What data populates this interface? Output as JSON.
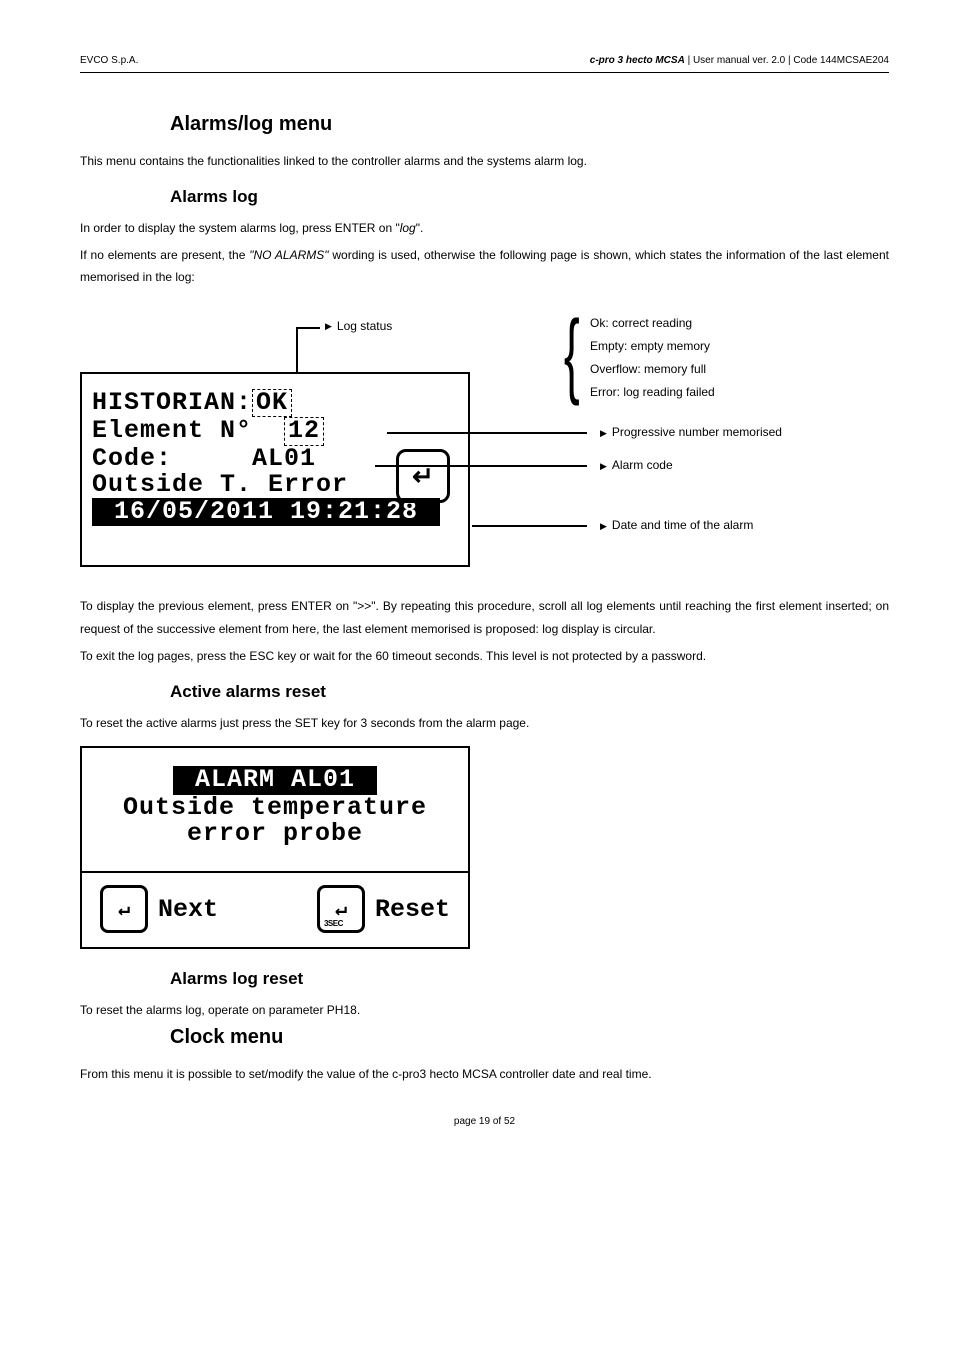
{
  "header": {
    "company": "EVCO S.p.A.",
    "product_bold": "c-pro 3 hecto MCSA",
    "product_rest": " | User manual ver. 2.0 | Code 144MCSAE204"
  },
  "sections": {
    "alarms_menu": {
      "title": "Alarms/log menu",
      "intro": "This menu contains the functionalities linked to the controller alarms and the systems alarm log."
    },
    "alarms_log": {
      "title": "Alarms log",
      "p1_a": "In order to display the system alarms log, press ENTER on \"",
      "p1_i": "log",
      "p1_b": "\".",
      "p2_a": "If no elements are present, the ",
      "p2_i": "\"NO ALARMS\"",
      "p2_b": " wording is used, otherwise the following page is shown, which states the information of the last element memorised in the log:",
      "p3": "To display the previous element, press ENTER on \">>\". By repeating this procedure, scroll all log elements until reaching the first element inserted; on request of the successive element from here, the last element memorised is proposed: log display is circular.",
      "p4": "To exit the log pages, press the ESC key or wait for the 60 timeout seconds. This level is not protected by a password."
    },
    "active_reset": {
      "title": "Active alarms reset",
      "p1": "To reset the active alarms just press the SET key for 3 seconds from the alarm page."
    },
    "log_reset": {
      "title": "Alarms log reset",
      "p1": "To reset the alarms log, operate on parameter PH18."
    },
    "clock_menu": {
      "title": "Clock menu",
      "p1": "From this menu it is possible to set/modify the value of the c-pro3 hecto MCSA controller date and real time."
    }
  },
  "diagram1": {
    "lcd_line1_a": "HISTORIAN:",
    "lcd_line1_b": "OK",
    "lcd_line2_a": "Element N°  ",
    "lcd_line2_b": "12",
    "lcd_line3": "Code:     AL01",
    "lcd_line4": "Outside T. Error",
    "lcd_line5": " 16/05/2011 19:21:28 ",
    "callouts": {
      "log_status": "Log status",
      "status_ok": "Ok: correct reading",
      "status_empty": "Empty: empty memory",
      "status_overflow": "Overflow: memory full",
      "status_error": "Error: log reading failed",
      "progressive": "Progressive number memorised",
      "alarm_code": "Alarm code",
      "datetime": "Date and time of the alarm"
    }
  },
  "diagram2": {
    "lcd_line1": " ALARM AL01 ",
    "lcd_line2": "Outside temperature",
    "lcd_line3": "error probe",
    "btn_next": "Next",
    "btn_reset": "Reset",
    "sub_3sec": "3SEC"
  },
  "footer": {
    "text": "page 19 of 52"
  }
}
